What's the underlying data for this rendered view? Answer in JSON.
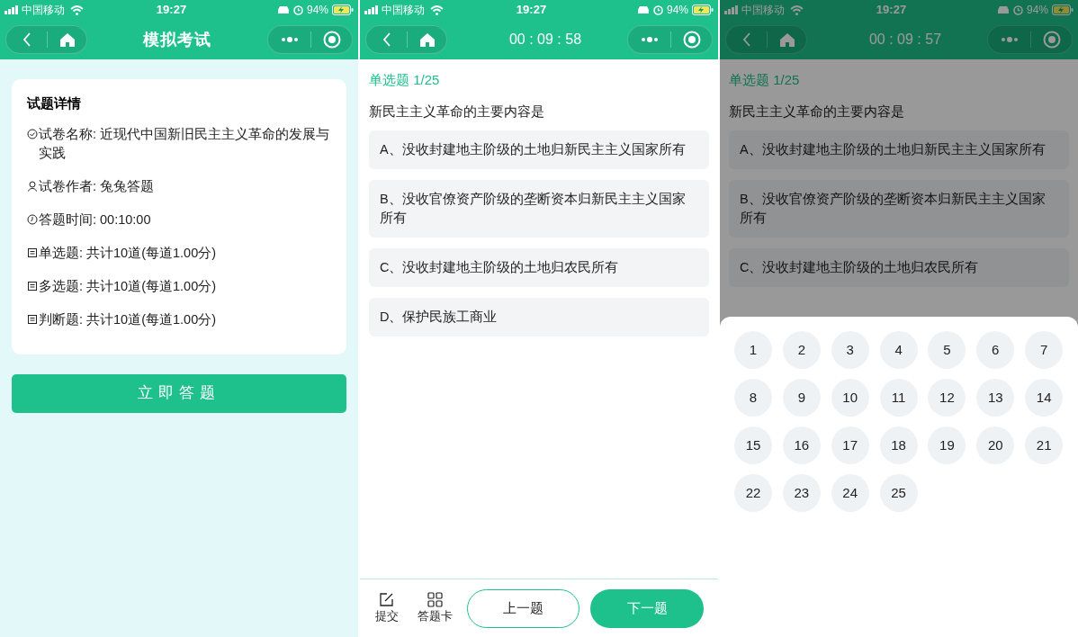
{
  "screens": [
    {
      "kind": "detail",
      "status_bar": {
        "carrier": "中国移动",
        "time": "19:27",
        "battery": "94%"
      },
      "nav_title": "模拟考试",
      "card": {
        "title": "试题详情",
        "lines": [
          {
            "kind": "name",
            "text": "试卷名称: 近现代中国新旧民主主义革命的发展与实践"
          },
          {
            "kind": "author",
            "text": "试卷作者: 兔兔答题"
          },
          {
            "kind": "time",
            "text": "答题时间: 00:10:00"
          },
          {
            "kind": "count",
            "text": "单选题: 共计10道(每道1.00分)"
          },
          {
            "kind": "count",
            "text": "多选题: 共计10道(每道1.00分)"
          },
          {
            "kind": "count",
            "text": "判断题: 共计10道(每道1.00分)"
          }
        ]
      },
      "start_button": "立即答题"
    },
    {
      "kind": "question",
      "status_bar": {
        "carrier": "中国移动",
        "time": "19:27",
        "battery": "94%"
      },
      "timer": "00 : 09 : 58",
      "question_label": "单选题 1/25",
      "question": "新民主主义革命的主要内容是",
      "options": [
        "A、没收封建地主阶级的土地归新民主主义国家所有",
        "B、没收官僚资产阶级的垄断资本归新民主主义国家所有",
        "C、没收封建地主阶级的土地归农民所有",
        "D、保护民族工商业"
      ],
      "footer": {
        "submit": "提交",
        "card": "答题卡",
        "prev": "上一题",
        "next": "下一题"
      }
    },
    {
      "kind": "question",
      "dimmed": true,
      "status_bar": {
        "carrier": "中国移动",
        "time": "19:27",
        "battery": "94%"
      },
      "timer": "00 : 09 : 57",
      "question_label": "单选题 1/25",
      "question": "新民主主义革命的主要内容是",
      "options": [
        "A、没收封建地主阶级的土地归新民主主义国家所有",
        "B、没收官僚资产阶级的垄断资本归新民主主义国家所有",
        "C、没收封建地主阶级的土地归农民所有"
      ],
      "answer_sheet": [
        "1",
        "2",
        "3",
        "4",
        "5",
        "6",
        "7",
        "8",
        "9",
        "10",
        "11",
        "12",
        "13",
        "14",
        "15",
        "16",
        "17",
        "18",
        "19",
        "20",
        "21",
        "22",
        "23",
        "24",
        "25"
      ]
    }
  ]
}
